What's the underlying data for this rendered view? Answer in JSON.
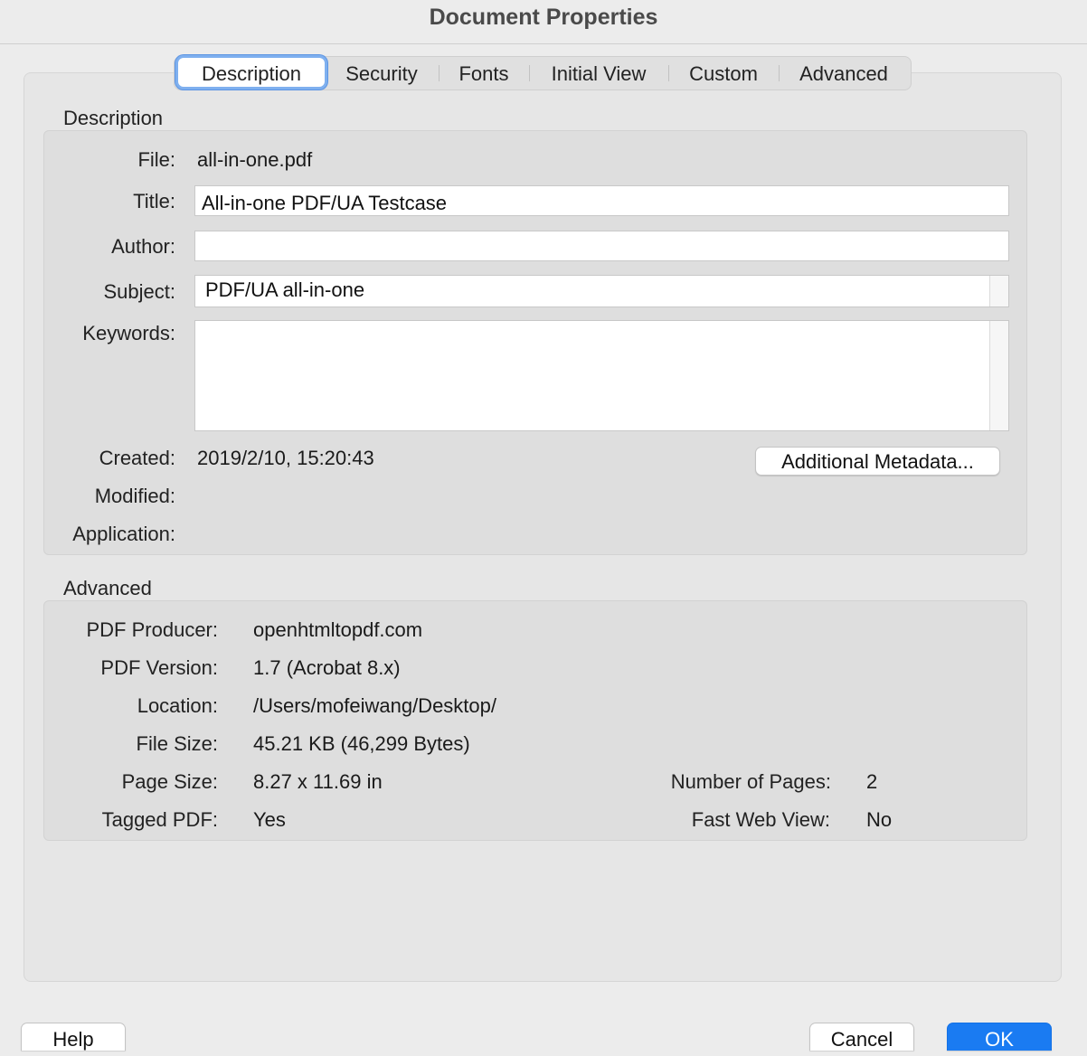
{
  "window": {
    "title": "Document Properties"
  },
  "tabs": [
    {
      "label": "Description",
      "active": true
    },
    {
      "label": "Security"
    },
    {
      "label": "Fonts"
    },
    {
      "label": "Initial View"
    },
    {
      "label": "Custom"
    },
    {
      "label": "Advanced"
    }
  ],
  "description": {
    "section_label": "Description",
    "file_label": "File:",
    "file_value": "all-in-one.pdf",
    "title_label": "Title:",
    "title_value": "All-in-one PDF/UA Testcase",
    "author_label": "Author:",
    "author_value": "",
    "subject_label": "Subject:",
    "subject_value": "PDF/UA all-in-one",
    "keywords_label": "Keywords:",
    "keywords_value": "",
    "created_label": "Created:",
    "created_value": "2019/2/10, 15:20:43",
    "modified_label": "Modified:",
    "modified_value": "",
    "application_label": "Application:",
    "application_value": "",
    "metadata_button": "Additional Metadata..."
  },
  "advanced": {
    "section_label": "Advanced",
    "producer_label": "PDF Producer:",
    "producer_value": "openhtmltopdf.com",
    "version_label": "PDF Version:",
    "version_value": "1.7 (Acrobat 8.x)",
    "location_label": "Location:",
    "location_value": "/Users/mofeiwang/Desktop/",
    "filesize_label": "File Size:",
    "filesize_value": "45.21 KB (46,299 Bytes)",
    "pagesize_label": "Page Size:",
    "pagesize_value": "8.27 x 11.69 in",
    "pages_label": "Number of Pages:",
    "pages_value": "2",
    "tagged_label": "Tagged PDF:",
    "tagged_value": "Yes",
    "fastweb_label": "Fast Web View:",
    "fastweb_value": "No"
  },
  "footer": {
    "help": "Help",
    "cancel": "Cancel",
    "ok": "OK"
  }
}
